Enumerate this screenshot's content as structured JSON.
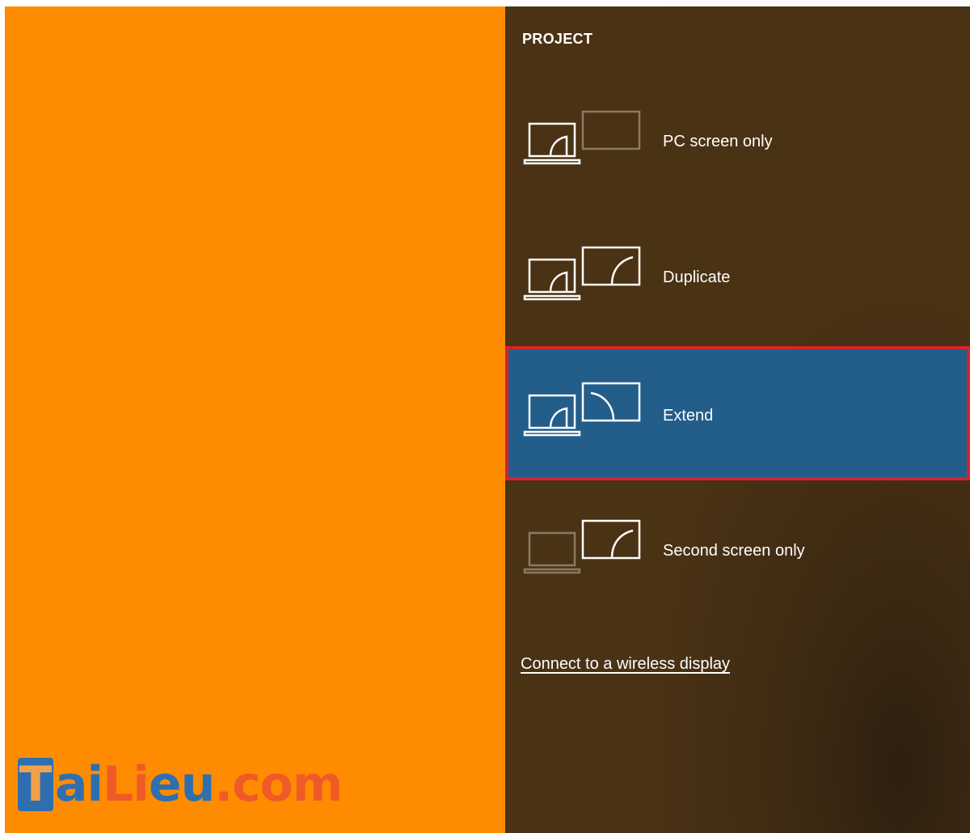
{
  "panel": {
    "title": "PROJECT",
    "options": [
      {
        "label": "PC screen only",
        "icon": "pc-screen-only-icon",
        "selected": false
      },
      {
        "label": "Duplicate",
        "icon": "duplicate-icon",
        "selected": false
      },
      {
        "label": "Extend",
        "icon": "extend-icon",
        "selected": true
      },
      {
        "label": "Second screen only",
        "icon": "second-screen-only-icon",
        "selected": false
      }
    ],
    "wireless_link": "Connect to a wireless display"
  },
  "watermark": {
    "box_letter": "T",
    "part_blue_1": "ai",
    "part_orange_1": "Li",
    "part_blue_2": "eu",
    "part_orange_2": ".com"
  },
  "colors": {
    "desktop_bg": "#ff8c00",
    "panel_bg": "#4b3214",
    "selected_bg": "#235d8a",
    "highlight_border": "#d6232b"
  }
}
